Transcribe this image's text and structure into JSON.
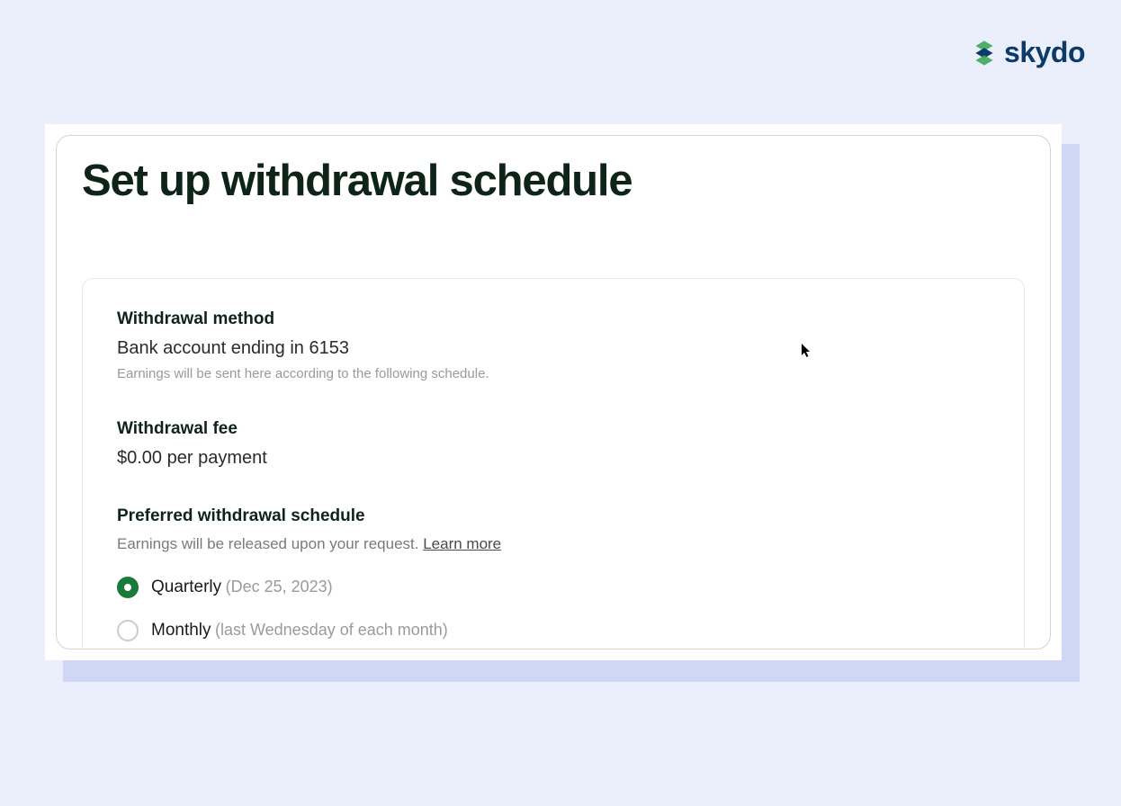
{
  "logo": {
    "text": "skydo"
  },
  "page": {
    "title": "Set up withdrawal schedule"
  },
  "withdrawal_method": {
    "label": "Withdrawal method",
    "value": "Bank account ending in 6153",
    "hint": "Earnings will be sent here according to the following schedule."
  },
  "withdrawal_fee": {
    "label": "Withdrawal fee",
    "value": "$0.00 per payment"
  },
  "schedule": {
    "label": "Preferred withdrawal schedule",
    "description": "Earnings will be released upon your request. ",
    "learn_more": "Learn more",
    "options": [
      {
        "label": "Quarterly",
        "note": "(Dec 25, 2023)",
        "selected": true
      },
      {
        "label": "Monthly",
        "note": "(last Wednesday of each month)",
        "selected": false
      }
    ]
  }
}
